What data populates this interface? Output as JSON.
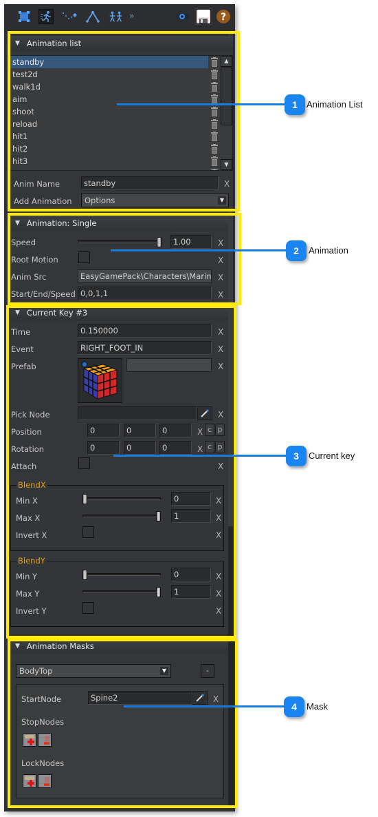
{
  "toolbar": {
    "icons": [
      {
        "name": "select-node-icon",
        "active": false
      },
      {
        "name": "animation-run-icon",
        "active": true
      },
      {
        "name": "curve-points-icon",
        "active": false
      },
      {
        "name": "bone-joint-icon",
        "active": false
      },
      {
        "name": "characters-icon",
        "active": false
      }
    ],
    "overflow": "»",
    "right_icons": [
      "eye-icon",
      "save-icon",
      "help-icon"
    ]
  },
  "animation_list": {
    "title": "Animation list",
    "items": [
      "standby",
      "test2d",
      "walk1d",
      "aim",
      "shoot",
      "reload",
      "hit1",
      "hit2",
      "hit3"
    ],
    "selected_index": 0,
    "anim_name_label": "Anim Name",
    "anim_name_value": "standby",
    "add_animation_label": "Add Animation",
    "add_animation_value": "Options"
  },
  "animation_single": {
    "title": "Animation: Single",
    "speed_label": "Speed",
    "speed_value": "1.00",
    "speed_slider_fraction": 1.0,
    "root_motion_label": "Root Motion",
    "root_motion_checked": false,
    "anim_src_label": "Anim Src",
    "anim_src_value": "EasyGamePack\\Characters\\Marine\\",
    "start_end_speed_label": "Start/End/Speed",
    "start_end_speed_value": "0,0,1,1"
  },
  "current_key": {
    "title": "Current Key #3",
    "time_label": "Time",
    "time_value": "0.150000",
    "event_label": "Event",
    "event_value": "RIGHT_FOOT_IN",
    "prefab_label": "Prefab",
    "prefab_value": "",
    "pick_node_label": "Pick Node",
    "pick_node_value": "",
    "position_label": "Position",
    "position_values": [
      "0",
      "0",
      "0"
    ],
    "rotation_label": "Rotation",
    "rotation_values": [
      "0",
      "0",
      "0"
    ],
    "attach_label": "Attach",
    "c_label": "c",
    "p_label": "p",
    "blend_x": {
      "title": "BlendX",
      "min_label": "Min X",
      "min_value": "0",
      "min_slider_fraction": 0.0,
      "max_label": "Max X",
      "max_value": "1",
      "max_slider_fraction": 1.0,
      "invert_label": "Invert X"
    },
    "blend_y": {
      "title": "BlendY",
      "min_label": "Min Y",
      "min_value": "0",
      "min_slider_fraction": 0.0,
      "max_label": "Max Y",
      "max_value": "1",
      "max_slider_fraction": 1.0,
      "invert_label": "Invert Y"
    }
  },
  "animation_masks": {
    "title": "Animation Masks",
    "mask_value": "BodyTop",
    "remove_label": "-",
    "start_node_label": "StartNode",
    "start_node_value": "Spine2",
    "stop_nodes_label": "StopNodes",
    "lock_nodes_label": "LockNodes"
  },
  "clear_label": "X",
  "callouts": [
    {
      "number": "1",
      "label": "Animation List"
    },
    {
      "number": "2",
      "label": "Animation"
    },
    {
      "number": "3",
      "label": "Current key"
    },
    {
      "number": "4",
      "label": "Mask"
    }
  ],
  "colors": {
    "highlight": "#ffea00",
    "callout": "#1a85f0",
    "selection": "#36587d",
    "group_title": "#e8a000"
  }
}
